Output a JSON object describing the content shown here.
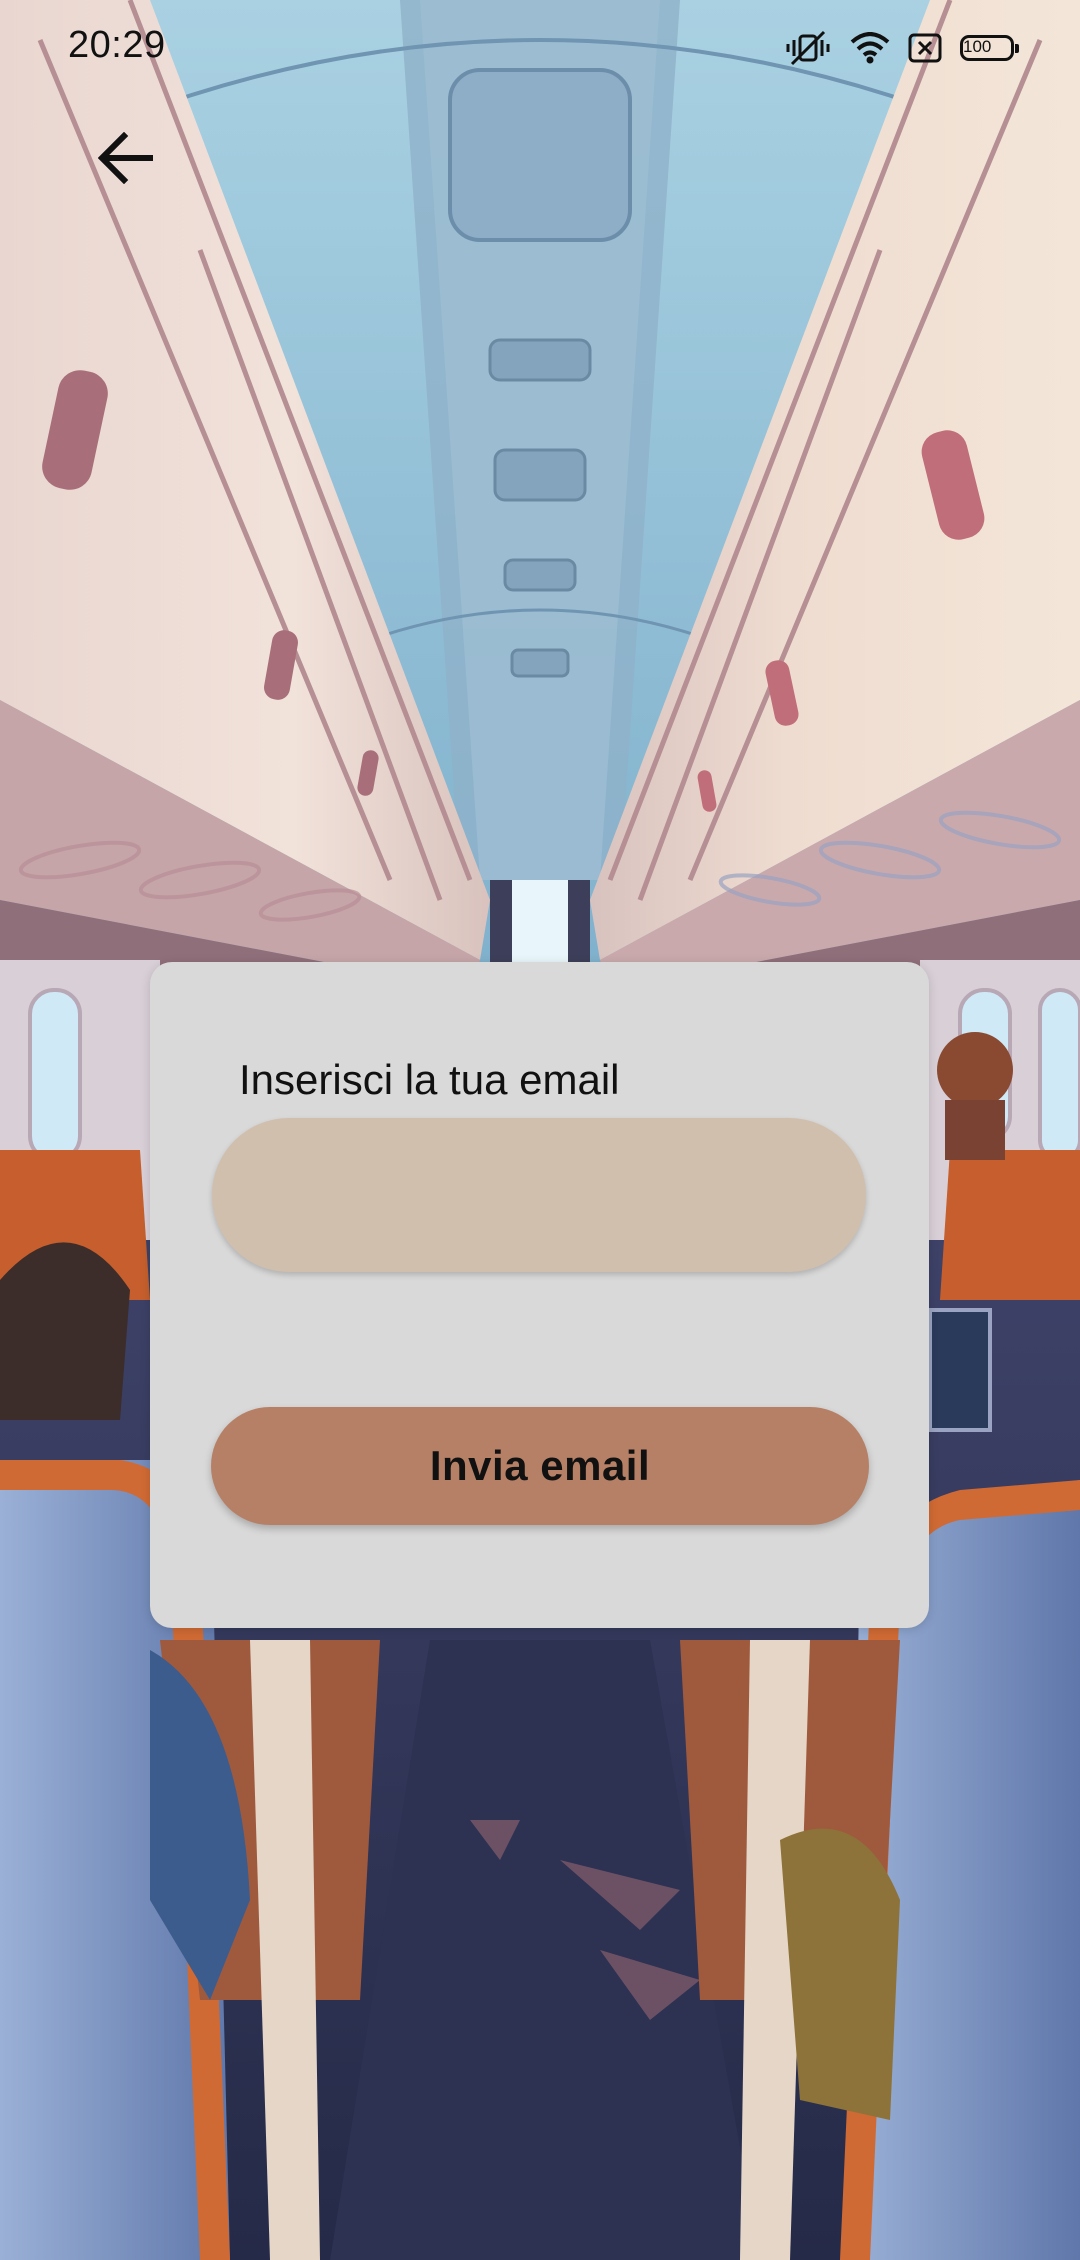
{
  "status_bar": {
    "time": "20:29",
    "battery": "100",
    "icons": [
      "vibrate-icon",
      "wifi-icon",
      "sim-off-icon",
      "battery-icon"
    ]
  },
  "header": {
    "back_icon": "arrow-left-icon"
  },
  "form": {
    "email_label": "Inserisci la tua email",
    "email_value": "",
    "email_placeholder": "",
    "submit_label": "Invia email"
  },
  "colors": {
    "card_background": "#d9d9d9",
    "input_background": "#d1bfae",
    "button_background": "#b68066",
    "text": "#111111"
  }
}
